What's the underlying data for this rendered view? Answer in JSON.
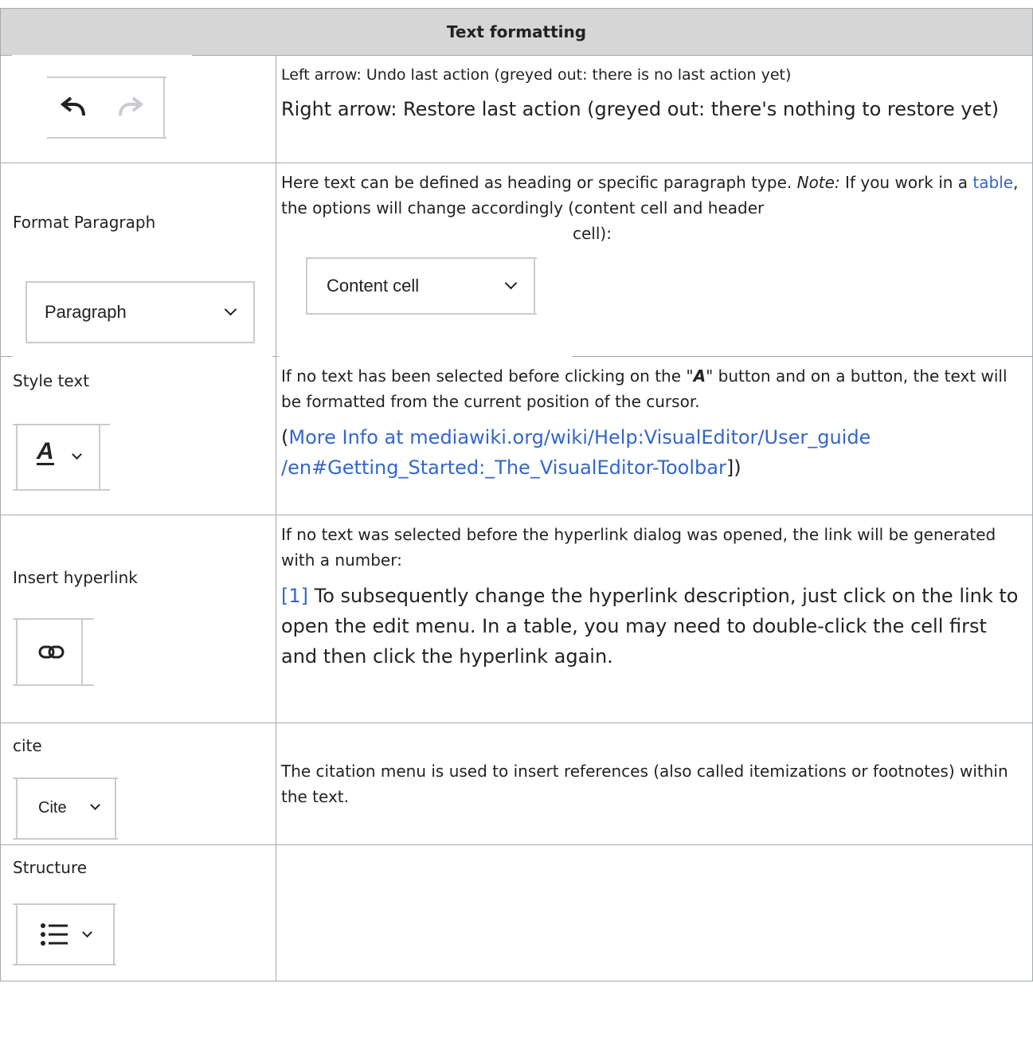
{
  "table": {
    "header": "Text formatting",
    "rows": [
      {
        "label": "",
        "icon": "undo-redo-toolbar",
        "desc1": "Left arrow: Undo last action (greyed out: there is no last action yet)",
        "desc2": "Right arrow: Restore last action (greyed out: there's nothing to restore yet)"
      },
      {
        "label": "Format Paragraph",
        "toolbar_text": "Paragraph",
        "desc_before": "Here text can be defined as heading or specific paragraph type.",
        "note": "Note:",
        "desc_mid": " If you work in a ",
        "link": "table",
        "desc_after": ", the options will change accordingly (content cell and header",
        "desc_end": "cell):",
        "image_text": "Content cell"
      },
      {
        "label": "Style text",
        "icon": "text-style-icon",
        "desc_a": "If no text has been selected before clicking on the \"",
        "desc_a_glyph": "A",
        "desc_b": "\" button and on a button, the text will be formatted from the current position of the cursor.",
        "info_open": "(",
        "info_link": "More Info at mediawiki.org/wiki/Help:VisualEditor/User_guide /en#Getting_Started:_The_VisualEditor-Toolbar",
        "info_close": "])"
      },
      {
        "label": "Insert hyperlink",
        "icon": "link-icon",
        "desc1": "If no text was selected before the hyperlink dialog was opened, the link will be generated with a number:",
        "ref": "[1]",
        "desc2": " To subsequently change the hyperlink description, just click on the link to open the edit menu. In a table, you may need to double-click the cell first and then click the hyperlink again."
      },
      {
        "label": "cite",
        "toolbar_text": "Cite",
        "desc1": "The citation menu is used to insert references (also called itemizations or footnotes) within the text."
      },
      {
        "label": "Structure",
        "icon": "bullet-list-icon",
        "desc1": ""
      }
    ]
  },
  "colors": {
    "link": "#3366cc",
    "header_bg": "#d6d6d6",
    "border": "#a2a9b1",
    "disabled_icon": "#c8ccd1"
  }
}
